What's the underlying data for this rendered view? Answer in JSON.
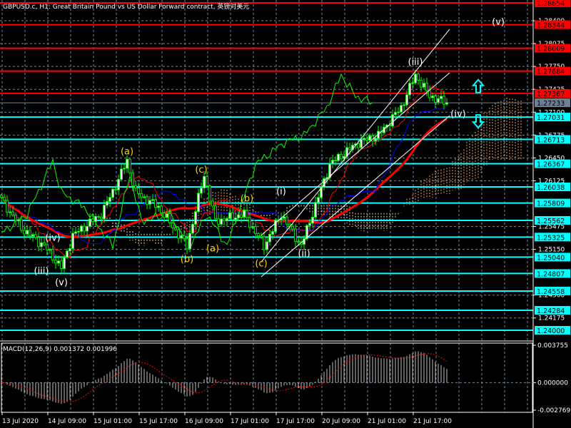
{
  "header": {
    "title": "GBPUSD.c, H1:  Great Britain Pound vs US Dollar Forward contract, 英镑对美元"
  },
  "colors": {
    "background": "#000000",
    "resistance": "#ff0000",
    "support": "#00ffff",
    "current_price": "#708090",
    "candle": "#00ff00",
    "tenkan": "#ff0000",
    "kijun": "#0000ff",
    "chikou": "#00ff00",
    "cloud_up": "#f4a460",
    "cloud_down": "#ffdead",
    "wave_abc": "#ffd700",
    "wave_roman": "#ffffff",
    "macd_hist": "#c0c0c0",
    "macd_signal": "#ff0000"
  },
  "chart_data": [
    {
      "type": "candlestick",
      "title": "GBPUSD.c, H1",
      "ylim": [
        1.2385,
        1.2868
      ],
      "y_ticks": [
        "1.28400",
        "1.28075",
        "1.27750",
        "1.27425",
        "1.27100",
        "1.26775",
        "1.26450",
        "1.26125",
        "1.25475",
        "1.25150",
        "1.24500",
        "1.24175"
      ],
      "x_ticks": [
        "13 Jul 2020",
        "14 Jul 09:00",
        "15 Jul 01:00",
        "15 Jul 17:00",
        "16 Jul 09:00",
        "17 Jul 01:00",
        "17 Jul 17:00",
        "20 Jul 09:00",
        "21 Jul 01:00",
        "21 Jul 17:00"
      ],
      "bars": 157,
      "close_path": [
        [
          0,
          1.2586
        ],
        [
          7,
          1.2545
        ],
        [
          15,
          1.252
        ],
        [
          21,
          1.2489
        ],
        [
          25,
          1.2535
        ],
        [
          35,
          1.2565
        ],
        [
          40,
          1.2606
        ],
        [
          44,
          1.2641
        ],
        [
          47,
          1.2596
        ],
        [
          55,
          1.2575
        ],
        [
          65,
          1.252
        ],
        [
          71,
          1.2621
        ],
        [
          75,
          1.2555
        ],
        [
          85,
          1.2565
        ],
        [
          92,
          1.252
        ],
        [
          98,
          1.2565
        ],
        [
          105,
          1.252
        ],
        [
          115,
          1.2636
        ],
        [
          125,
          1.2667
        ],
        [
          132,
          1.2677
        ],
        [
          140,
          1.2717
        ],
        [
          145,
          1.2763
        ],
        [
          150,
          1.2733
        ],
        [
          156,
          1.2723
        ]
      ],
      "resistance_levels": [
        "1.28654",
        "1.28344",
        "1.28009",
        "1.27684",
        "1.27367"
      ],
      "current_price": "1.27233",
      "support_levels": [
        "1.27031",
        "1.26713",
        "1.26367",
        "1.26038",
        "1.25809",
        "1.25562",
        "1.25325",
        "1.25040",
        "1.24807",
        "1.24558",
        "1.24284",
        "1.24000"
      ],
      "wave_labels": [
        {
          "text": "(iii)",
          "bar": 14,
          "price": 1.248,
          "kind": "roman"
        },
        {
          "text": "(iv)",
          "bar": 18,
          "price": 1.2527,
          "kind": "roman"
        },
        {
          "text": "(v)",
          "bar": 21,
          "price": 1.2464,
          "kind": "roman"
        },
        {
          "text": "(a)",
          "bar": 44,
          "price": 1.265,
          "kind": "abc"
        },
        {
          "text": "(b)",
          "bar": 65,
          "price": 1.2497,
          "kind": "abc"
        },
        {
          "text": "(c)",
          "bar": 70,
          "price": 1.2624,
          "kind": "abc"
        },
        {
          "text": "(a)",
          "bar": 74,
          "price": 1.2512,
          "kind": "abc"
        },
        {
          "text": "(b)",
          "bar": 86,
          "price": 1.2583,
          "kind": "abc"
        },
        {
          "text": "(c)",
          "bar": 91,
          "price": 1.2491,
          "kind": "abc"
        },
        {
          "text": "(i)",
          "bar": 98,
          "price": 1.2593,
          "kind": "roman"
        },
        {
          "text": "(ii)",
          "bar": 106,
          "price": 1.2505,
          "kind": "roman"
        },
        {
          "text": "(iii)",
          "bar": 145,
          "price": 1.2777,
          "kind": "roman"
        },
        {
          "text": "(iv)",
          "bar": 160,
          "price": 1.2703,
          "kind": "roman"
        },
        {
          "text": "(v)",
          "bar": 174,
          "price": 1.2834,
          "kind": "roman"
        }
      ],
      "channel_lines": [
        {
          "from": [
            91,
            1.2497
          ],
          "to": [
            157,
            1.2828
          ]
        },
        {
          "from": [
            91,
            1.2535
          ],
          "to": [
            157,
            1.2766
          ]
        },
        {
          "from": [
            91,
            1.2476
          ],
          "to": [
            157,
            1.2705
          ]
        }
      ],
      "signals": [
        {
          "type": "arrow-up",
          "bar": 167,
          "price": 1.2747
        },
        {
          "type": "arrow-down",
          "bar": 167,
          "price": 1.2697
        }
      ]
    },
    {
      "type": "bar",
      "title": "MACD(12,26,9) 0.001372 0.001996",
      "label": "MACD(12,26,9) 0.001372 0.001996",
      "main": 0.001372,
      "signal": 0.001996,
      "ylim": [
        -0.002769,
        0.003755
      ],
      "y_ticks": [
        "0.003755",
        "0.000000",
        "-0.002769"
      ]
    }
  ]
}
